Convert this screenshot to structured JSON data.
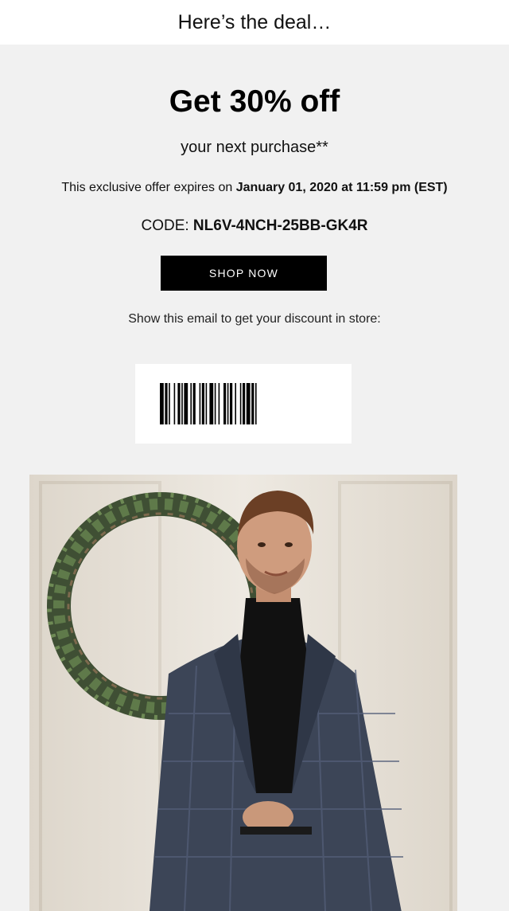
{
  "header": {
    "title": "Here’s the deal…"
  },
  "offer": {
    "headline": "Get 30% off",
    "subline": "your next purchase**",
    "expiry_prefix": "This exclusive offer expires on ",
    "expiry_date": "January 01, 2020 at 11:59 pm (EST)",
    "code_label": "CODE: ",
    "code_value": "NL6V-4NCH-25BB-GK4R",
    "cta_label": "SHOP NOW",
    "instore_text": "Show this email to get your discount in store:"
  },
  "barcode": {
    "icon": "barcode-icon"
  },
  "photo": {
    "description_icon": "man-in-suit-with-wreath-photo"
  },
  "colors": {
    "cta_bg": "#000000",
    "cta_text": "#ffffff",
    "panel_bg": "#f1f1f1"
  }
}
